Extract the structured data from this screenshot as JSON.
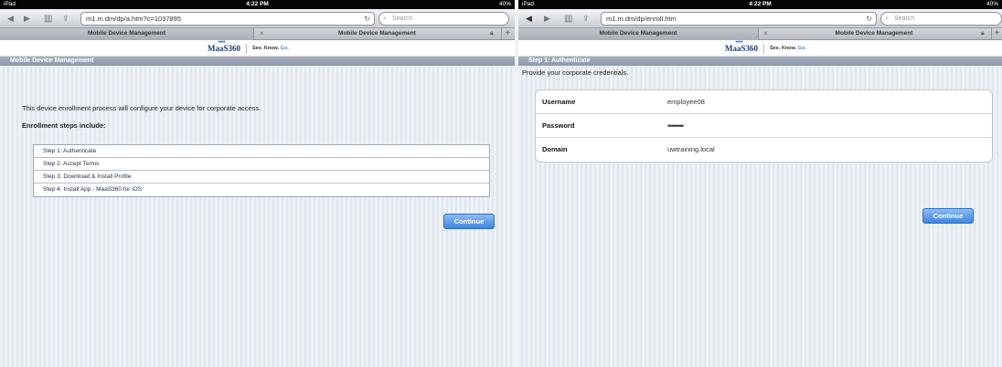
{
  "left": {
    "status": {
      "device": "iPad",
      "time": "4:22 PM",
      "battery": "40%"
    },
    "toolbar": {
      "url": "m1.m.dm/dp/a.htm?c=1037895",
      "search_placeholder": "Search"
    },
    "tabs": {
      "active": "Mobile Device Management",
      "inactive": "Mobile Device Management"
    },
    "logo": {
      "brand": "MaaS360",
      "tagline_prefix": "See. Know.",
      "tagline_go": "Go."
    },
    "section_title": "Mobile Device Management",
    "intro": "This device enrollment process will configure your device for corporate access.",
    "steps_title": "Enrollment steps include:",
    "steps": [
      "Step 1: Authenticate",
      "Step 2: Accept Terms",
      "Step 3: Download & Install Profile",
      "Step 4: Install App - MaaS360 for iOS"
    ],
    "continue_label": "Continue"
  },
  "right": {
    "status": {
      "device": "iPad",
      "time": "4:22 PM",
      "battery": "40%"
    },
    "toolbar": {
      "url": "m1.m.dm/dp/enroll.htm",
      "search_placeholder": "Search"
    },
    "tabs": {
      "active": "Mobile Device Management",
      "inactive": "Mobile Device Management"
    },
    "logo": {
      "brand": "MaaS360",
      "tagline_prefix": "See. Know.",
      "tagline_go": "Go."
    },
    "section_title": "Step 1: Authenticate",
    "intro": "Provide your corporate credentials.",
    "fields": [
      {
        "label": "Username",
        "value": "employee08"
      },
      {
        "label": "Password",
        "value": "••••••••"
      },
      {
        "label": "Domain",
        "value": "uwtraining.local"
      }
    ],
    "continue_label": "Continue"
  },
  "colors": {
    "accent": "#3d86e0",
    "header": "#8f99ad"
  }
}
